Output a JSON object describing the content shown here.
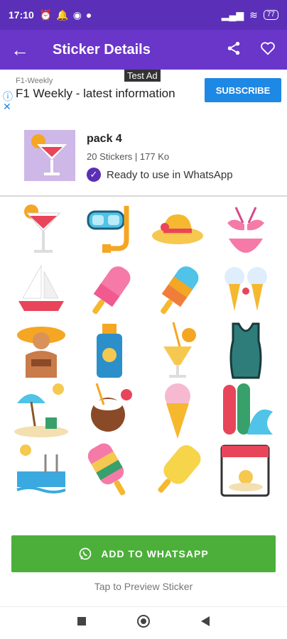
{
  "status_bar": {
    "time": "17:10",
    "battery": "77"
  },
  "app_bar": {
    "title": "Sticker Details"
  },
  "ad": {
    "label": "Test Ad",
    "advertiser": "F1-Weekly",
    "headline": "F1 Weekly - latest information",
    "cta": "SUBSCRIBE"
  },
  "pack": {
    "name": "pack 4",
    "meta": "20 Stickers | 177 Ko",
    "status": "Ready to use in WhatsApp"
  },
  "stickers": [
    "cocktail",
    "snorkel-mask",
    "sun-hat",
    "bikini",
    "sailboat",
    "ice-pop-pink",
    "ice-pop-orange",
    "ice-cream-cones",
    "woman-sunhat",
    "sunscreen",
    "orange-juice",
    "swimsuit",
    "beach-umbrella",
    "coconut-drink",
    "ice-cream-cone",
    "surfboards",
    "swimming-pool",
    "ice-pop-striped",
    "ice-pop-yellow",
    "beach-calendar"
  ],
  "cta": {
    "label": "ADD TO WHATSAPP"
  },
  "hint": "Tap to Preview Sticker",
  "colors": {
    "status_bar": "#5b2fb8",
    "app_bar": "#6a35c9",
    "cta": "#4caf3a",
    "ad_button": "#1e88e5"
  }
}
